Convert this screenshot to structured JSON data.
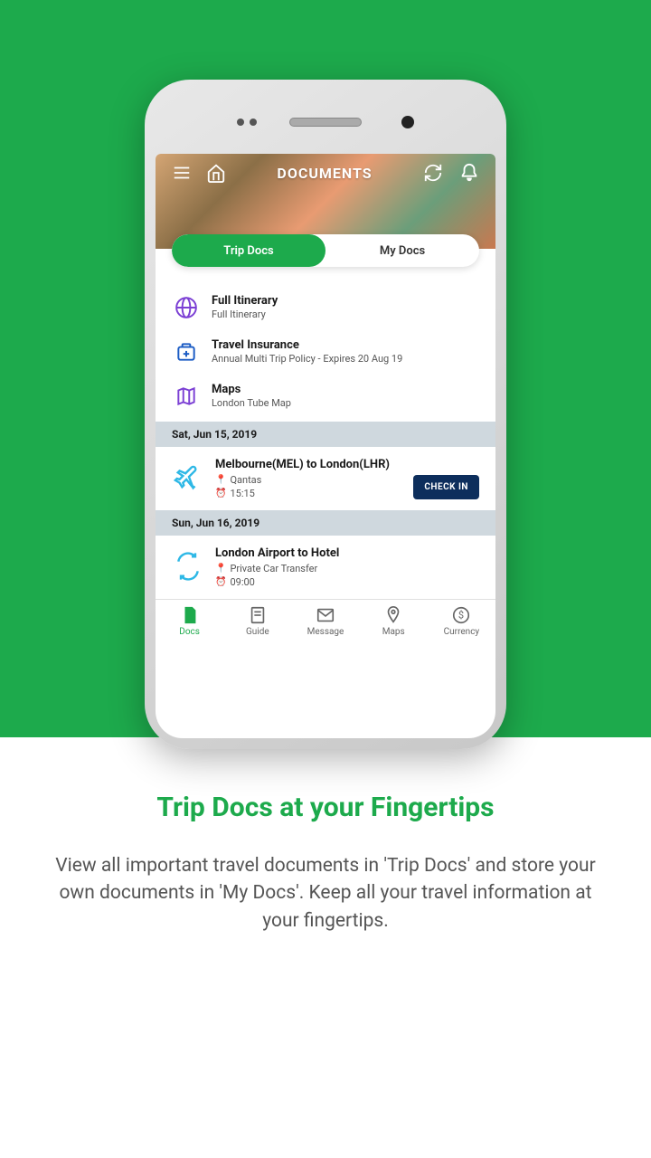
{
  "header": {
    "title": "DOCUMENTS"
  },
  "tabs": {
    "trip_docs": "Trip Docs",
    "my_docs": "My Docs"
  },
  "docs": [
    {
      "title": "Full Itinerary",
      "sub": "Full Itinerary"
    },
    {
      "title": "Travel Insurance",
      "sub": "Annual Multi Trip Policy - Expires 20 Aug 19"
    },
    {
      "title": "Maps",
      "sub": "London Tube Map"
    }
  ],
  "days": [
    {
      "date": "Sat, Jun 15, 2019",
      "item": {
        "title": "Melbourne(MEL) to London(LHR)",
        "provider": "Qantas",
        "time": "15:15",
        "checkin": "CHECK IN"
      }
    },
    {
      "date": "Sun, Jun 16, 2019",
      "item": {
        "title": "London Airport to Hotel",
        "provider": "Private Car Transfer",
        "time": "09:00"
      }
    }
  ],
  "nav": {
    "docs": "Docs",
    "guide": "Guide",
    "message": "Message",
    "maps": "Maps",
    "currency": "Currency"
  },
  "promo": {
    "title": "Trip Docs at your Fingertips",
    "text": "View all important travel documents in 'Trip Docs' and store your own documents in 'My Docs'. Keep all your travel information at your fingertips."
  },
  "colors": {
    "accent": "#1daa4c",
    "navy": "#0d2e5c"
  }
}
